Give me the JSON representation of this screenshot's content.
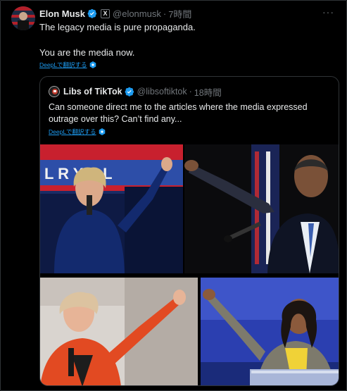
{
  "tweet": {
    "author_name": "Elon Musk",
    "handle": "@elonmusk",
    "separator": "·",
    "time": "7時間",
    "x_badge": "X",
    "more_icon": "more-icon",
    "text_line1": "The legacy media is pure propaganda.",
    "text_line2": "You are the media now.",
    "translate_label": "DeepLで翻訳する"
  },
  "quote": {
    "author_name": "Libs of TikTok",
    "handle": "@libsoftiktok",
    "separator": "·",
    "time": "18時間",
    "text_line1": "Can someone direct me to the articles where the media expressed",
    "text_line2": "outrage over this? Can’t find any...",
    "translate_label": "DeepLで翻訳する",
    "photo_sign_text": "L   R Y C L"
  },
  "colors": {
    "verified": "#1d9bf0",
    "link": "#1d9bf0",
    "muted": "#71767b",
    "border": "#2f3336"
  }
}
